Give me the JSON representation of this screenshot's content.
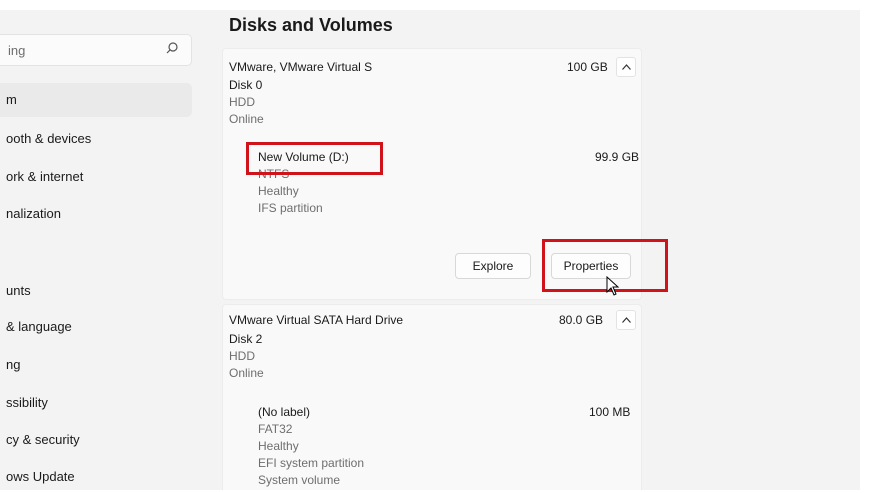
{
  "sidebar": {
    "search_text": "ing",
    "items": [
      {
        "label": "m",
        "active": true
      },
      {
        "label": "ooth & devices"
      },
      {
        "label": "ork & internet"
      },
      {
        "label": "nalization"
      },
      {
        "label": "unts"
      },
      {
        "label": "& language"
      },
      {
        "label": "ng"
      },
      {
        "label": "ssibility"
      },
      {
        "label": "cy & security"
      },
      {
        "label": "ows Update"
      }
    ]
  },
  "main": {
    "title": "Disks and Volumes",
    "disks": [
      {
        "name": "VMware, VMware Virtual S",
        "size": "100 GB",
        "disk": "Disk 0",
        "type": "HDD",
        "status": "Online",
        "volume": {
          "name": "New Volume (D:)",
          "size": "99.9 GB",
          "fs": "NTFS",
          "health": "Healthy",
          "partition": "IFS partition"
        },
        "actions": {
          "explore": "Explore",
          "properties": "Properties"
        }
      },
      {
        "name": "VMware Virtual SATA Hard Drive",
        "size": "80.0 GB",
        "disk": "Disk 2",
        "type": "HDD",
        "status": "Online",
        "volume": {
          "name": "(No label)",
          "size": "100 MB",
          "fs": "FAT32",
          "health": "Healthy",
          "partition": "EFI system partition",
          "extra": "System volume"
        }
      }
    ]
  },
  "colors": {
    "highlight": "#d0121b",
    "background": "#f3f3f3",
    "card": "#f9f9f9"
  }
}
